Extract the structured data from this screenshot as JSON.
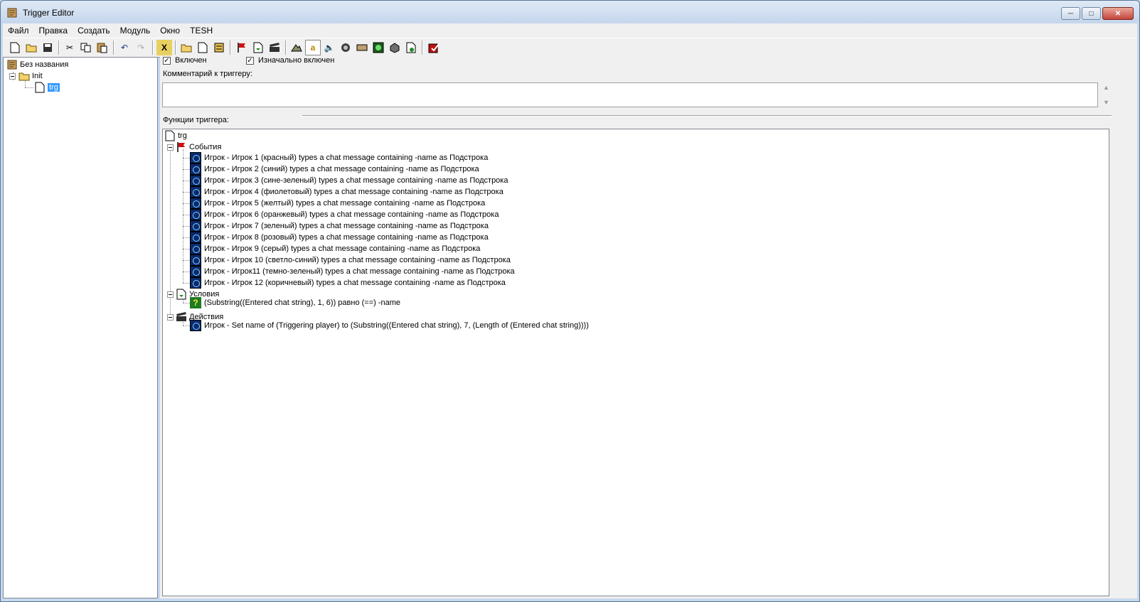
{
  "window": {
    "title": "Trigger Editor"
  },
  "menu": [
    "Файл",
    "Правка",
    "Создать",
    "Модуль",
    "Окно",
    "TESH"
  ],
  "left_tree": {
    "root": "Без названия",
    "category": "Init",
    "trigger": "trg"
  },
  "trigger_props": {
    "enabled_label": "Включен",
    "enabled": true,
    "initially_on_label": "Изначально включен",
    "initially_on": true,
    "comment_label": "Комментарий к триггеру:",
    "comment": ""
  },
  "functions": {
    "label": "Функции триггера:",
    "trigger_name": "trg",
    "events_label": "События",
    "events": [
      "Игрок - Игрок 1 (красный) types a chat message containing -name  as Подстрока",
      "Игрок - Игрок 2 (синий) types a chat message containing -name  as Подстрока",
      "Игрок - Игрок 3 (сине-зеленый) types a chat message containing -name  as Подстрока",
      "Игрок - Игрок 4 (фиолетовый) types a chat message containing -name  as Подстрока",
      "Игрок - Игрок 5 (желтый) types a chat message containing -name  as Подстрока",
      "Игрок - Игрок 6 (оранжевый) types a chat message containing -name  as Подстрока",
      "Игрок - Игрок 7 (зеленый) types a chat message containing -name  as Подстрока",
      "Игрок - Игрок 8 (розовый) types a chat message containing -name  as Подстрока",
      "Игрок - Игрок 9 (серый) types a chat message containing -name  as Подстрока",
      "Игрок - Игрок 10 (светло-синий) types a chat message containing -name  as Подстрока",
      "Игрок - Игрок11 (темно-зеленый) types a chat message containing -name  as Подстрока",
      "Игрок - Игрок 12 (коричневый) types a chat message containing -name  as Подстрока"
    ],
    "conditions_label": "Условия",
    "conditions": [
      "(Substring((Entered chat string), 1, 6)) равно (==) -name"
    ],
    "actions_label": "Действия",
    "actions": [
      "Игрок - Set name of (Triggering player) to (Substring((Entered chat string), 7, (Length of (Entered chat string))))"
    ]
  }
}
